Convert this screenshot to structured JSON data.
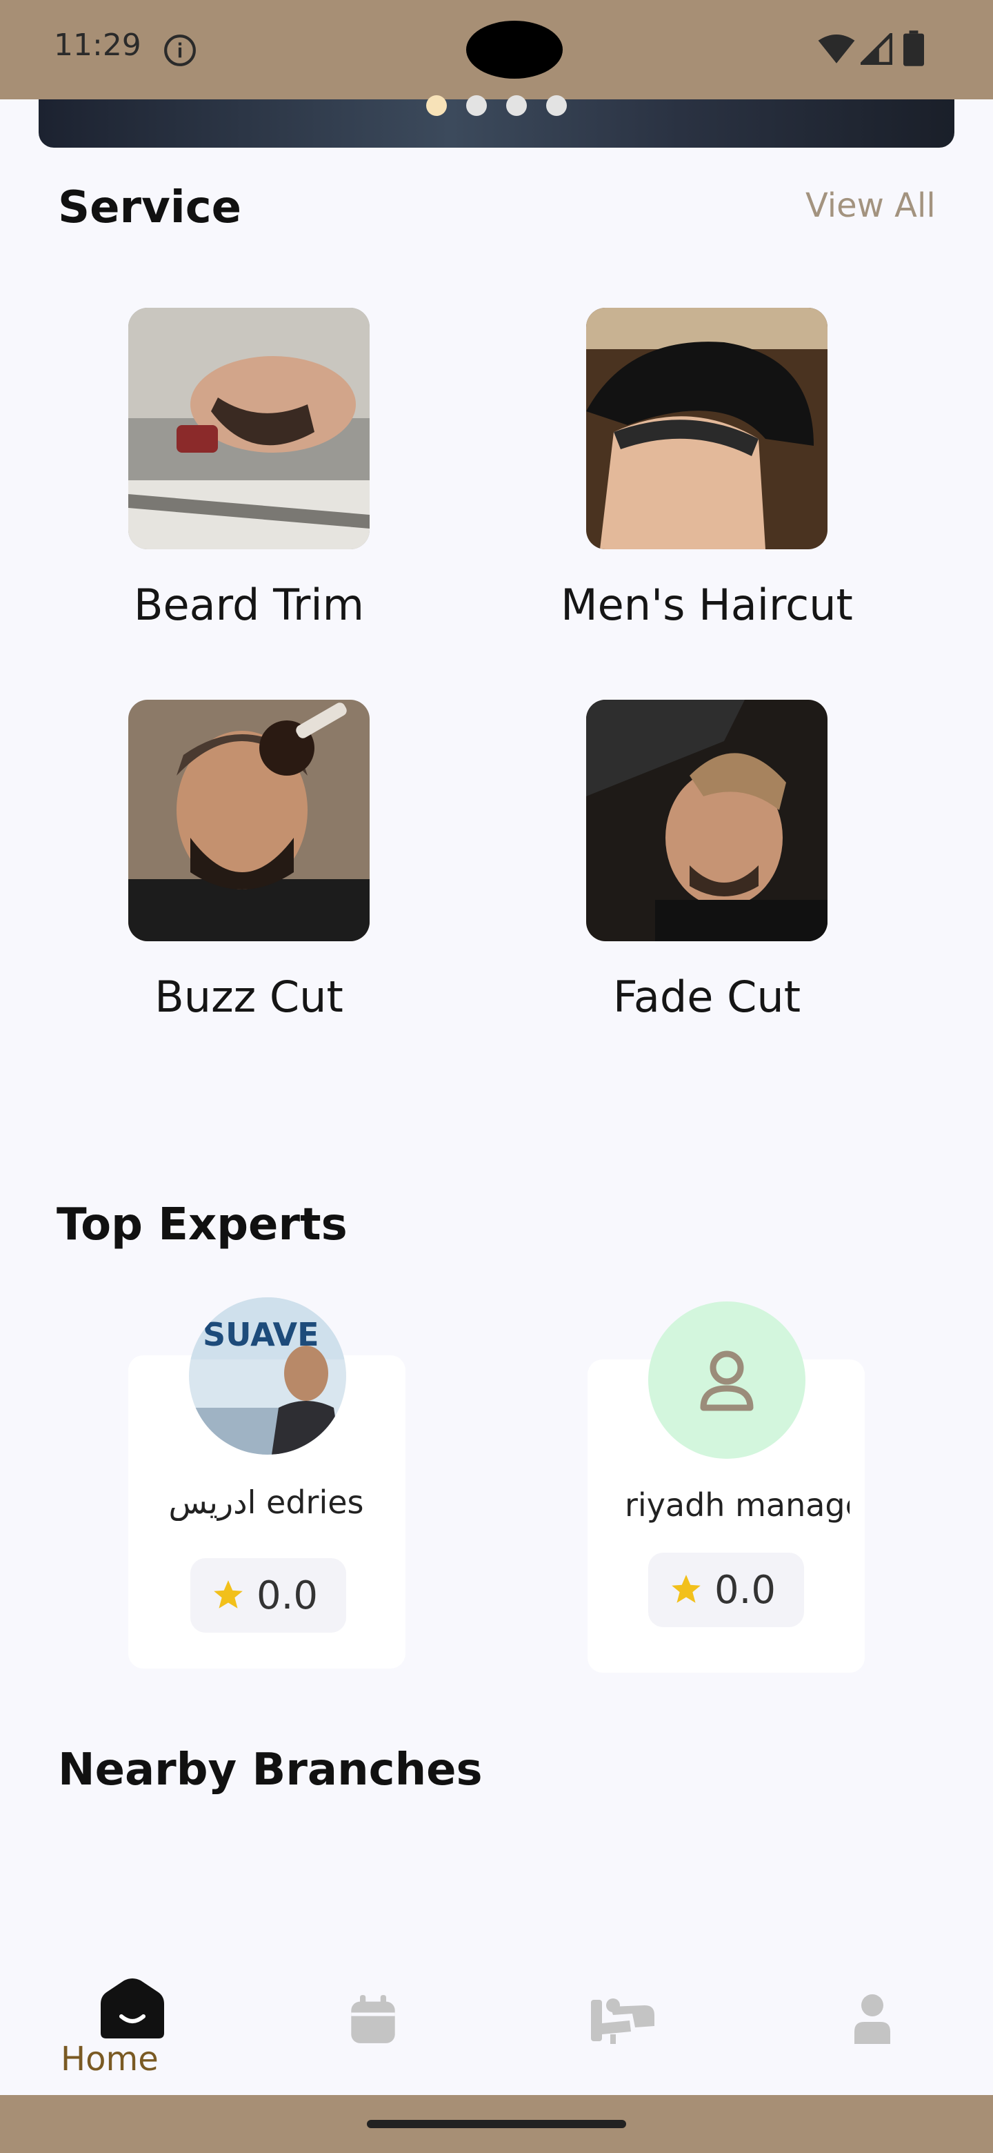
{
  "status_bar": {
    "time": "11:29",
    "icons": [
      "info-icon",
      "wifi-icon",
      "signal-icon",
      "battery-icon"
    ]
  },
  "banner": {
    "dots_total": 4,
    "active_index": 0
  },
  "services": {
    "title": "Service",
    "view_all": "View All",
    "items": [
      {
        "label": "Beard Trim"
      },
      {
        "label": "Men's Haircut"
      },
      {
        "label": "Buzz Cut"
      },
      {
        "label": "Fade Cut"
      }
    ]
  },
  "experts": {
    "title": "Top Experts",
    "items": [
      {
        "name": "ادريس edries",
        "rating": "0.0"
      },
      {
        "name": "riyadh manager",
        "rating": "0.0"
      }
    ]
  },
  "nearby": {
    "title": "Nearby Branches"
  },
  "bottom_nav": {
    "items": [
      {
        "label": "Home",
        "icon": "home-icon",
        "active": true
      },
      {
        "label": "",
        "icon": "calendar-icon",
        "active": false
      },
      {
        "label": "",
        "icon": "barber-chair-icon",
        "active": false
      },
      {
        "label": "",
        "icon": "profile-icon",
        "active": false
      }
    ],
    "active_color": "#7a5a23"
  },
  "colors": {
    "system_bar": "#a78f75",
    "background": "#f8f8fd",
    "accent_text": "#a3937f"
  }
}
